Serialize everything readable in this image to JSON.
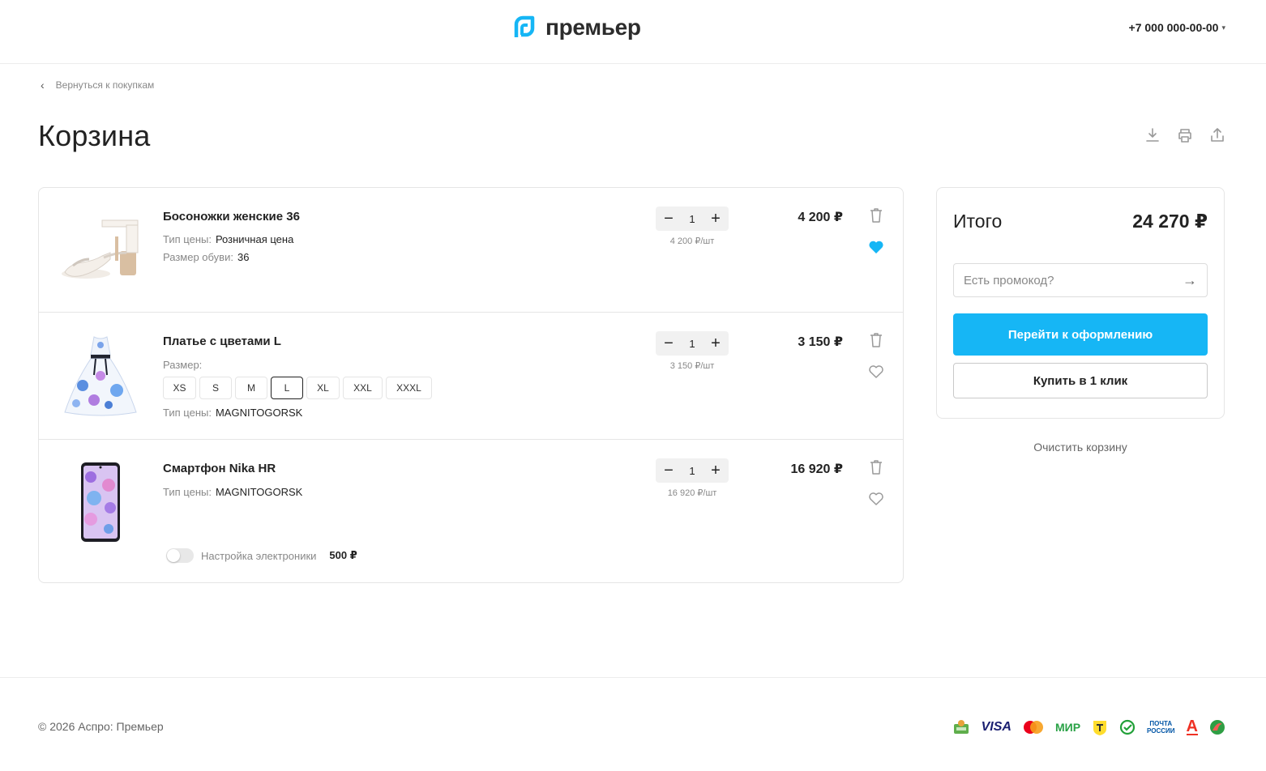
{
  "header": {
    "logo_text": "премьер",
    "phone": "+7 000 000-00-00"
  },
  "nav": {
    "back_label": "Вернуться к покупкам"
  },
  "page": {
    "title": "Корзина"
  },
  "items": [
    {
      "name": "Босоножки женские 36",
      "props": [
        {
          "label": "Тип цены:",
          "value": "Розничная цена"
        },
        {
          "label": "Размер обуви:",
          "value": "36"
        }
      ],
      "qty": "1",
      "unit_price": "4 200 ₽/шт",
      "price": "4 200 ₽",
      "favorite": true
    },
    {
      "name": "Платье с цветами L",
      "size_label": "Размер:",
      "sizes": [
        "XS",
        "S",
        "M",
        "L",
        "XL",
        "XXL",
        "XXXL"
      ],
      "selected_size": "L",
      "props": [
        {
          "label": "Тип цены:",
          "value": "MAGNITOGORSK"
        }
      ],
      "qty": "1",
      "unit_price": "3 150 ₽/шт",
      "price": "3 150 ₽",
      "favorite": false
    },
    {
      "name": "Смартфон Nika HR",
      "props": [
        {
          "label": "Тип цены:",
          "value": "MAGNITOGORSK"
        }
      ],
      "qty": "1",
      "unit_price": "16 920 ₽/шт",
      "price": "16 920 ₽",
      "favorite": false,
      "service": {
        "label": "Настройка электроники",
        "price": "500 ₽",
        "enabled": false
      }
    }
  ],
  "summary": {
    "label": "Итого",
    "total": "24 270 ₽",
    "promo_placeholder": "Есть промокод?",
    "checkout_label": "Перейти к оформлению",
    "oneclick_label": "Купить в 1 клик",
    "clear_label": "Очистить корзину"
  },
  "footer": {
    "copyright": "© 2026 Аспро: Премьер",
    "payment_icons": [
      "cash-icon",
      "visa-icon",
      "mastercard-icon",
      "mir-icon",
      "tbank-icon",
      "sberpay-icon",
      "pochta-rossii-icon",
      "alfa-bank-icon",
      "other-bank-icon"
    ],
    "payment_texts": {
      "visa": "VISA",
      "mir": "МИР",
      "pochta_line1": "ПОЧТА",
      "pochta_line2": "РОССИИ",
      "alfa": "А"
    }
  },
  "colors": {
    "accent": "#16b6f5",
    "text": "#222222",
    "muted": "#888888",
    "border": "#e5e5e5"
  }
}
